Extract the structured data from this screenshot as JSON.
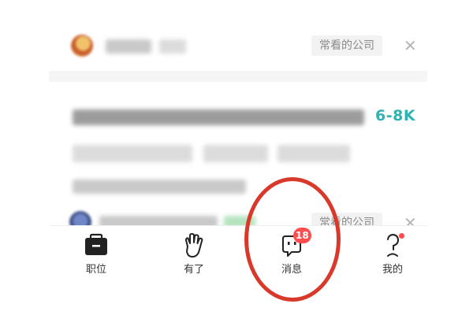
{
  "cards": [
    {
      "company_tag": "常看的公司",
      "close_icon": "close-icon"
    },
    {
      "salary": "6-8K"
    },
    {
      "company_tag": "常看的公司",
      "close_icon": "close-icon"
    }
  ],
  "tabbar": {
    "items": [
      {
        "label": "职位",
        "icon": "briefcase-icon"
      },
      {
        "label": "有了",
        "icon": "hand-icon"
      },
      {
        "label": "消息",
        "icon": "message-icon",
        "badge": "18"
      },
      {
        "label": "我的",
        "icon": "profile-icon",
        "dot": true
      }
    ]
  },
  "colors": {
    "salary": "#2fb2b1",
    "badge": "#ff4d4f",
    "annotation_circle": "#d8392a"
  }
}
